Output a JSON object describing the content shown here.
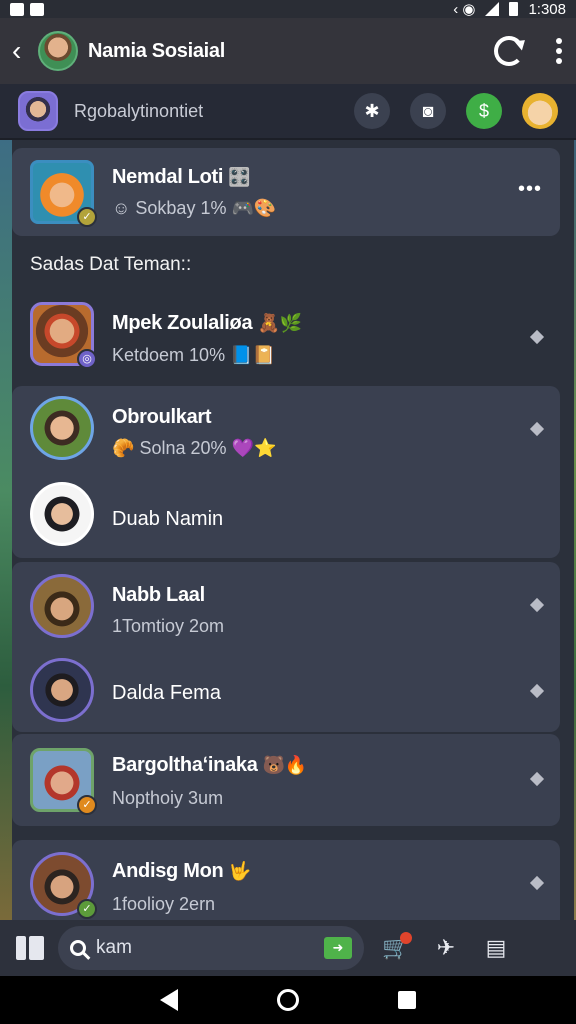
{
  "status_bar": {
    "time": "1:308"
  },
  "header": {
    "title": "Namia Sosiaial"
  },
  "subheader": {
    "title": "Rgobalytinontiet"
  },
  "pinned": {
    "name": "Nemdal Loti",
    "name_emoji": "🎛️",
    "status": "Sokbay 1%",
    "status_emoji": "🎮🎨"
  },
  "section": {
    "label": "Sadas Dat Teman::"
  },
  "friends": [
    {
      "name": "Mpek Zoulaliøa",
      "emoji": "🧸🌿",
      "status": "Ketdoem 10%",
      "status_emoji": "📘📔"
    },
    {
      "name": "Obroulkart",
      "emoji": "",
      "status": "Solna 20%",
      "status_emoji": "💜⭐"
    },
    {
      "name": "Duab Namin",
      "emoji": "",
      "status": "",
      "status_emoji": ""
    },
    {
      "name": "Nabb Laal",
      "emoji": "",
      "status": "1Tomtioy 2om",
      "status_emoji": ""
    },
    {
      "name": "Dalda Fema",
      "emoji": "",
      "status": "",
      "status_emoji": ""
    },
    {
      "name": "Bargolthaʻinaka",
      "emoji": "🐻🔥",
      "status": "Nopthoiy 3um",
      "status_emoji": ""
    },
    {
      "name": "Andisg Mon",
      "emoji": "🤟",
      "status": "1foolioy 2ern",
      "status_emoji": ""
    }
  ],
  "search": {
    "value": "kam"
  }
}
